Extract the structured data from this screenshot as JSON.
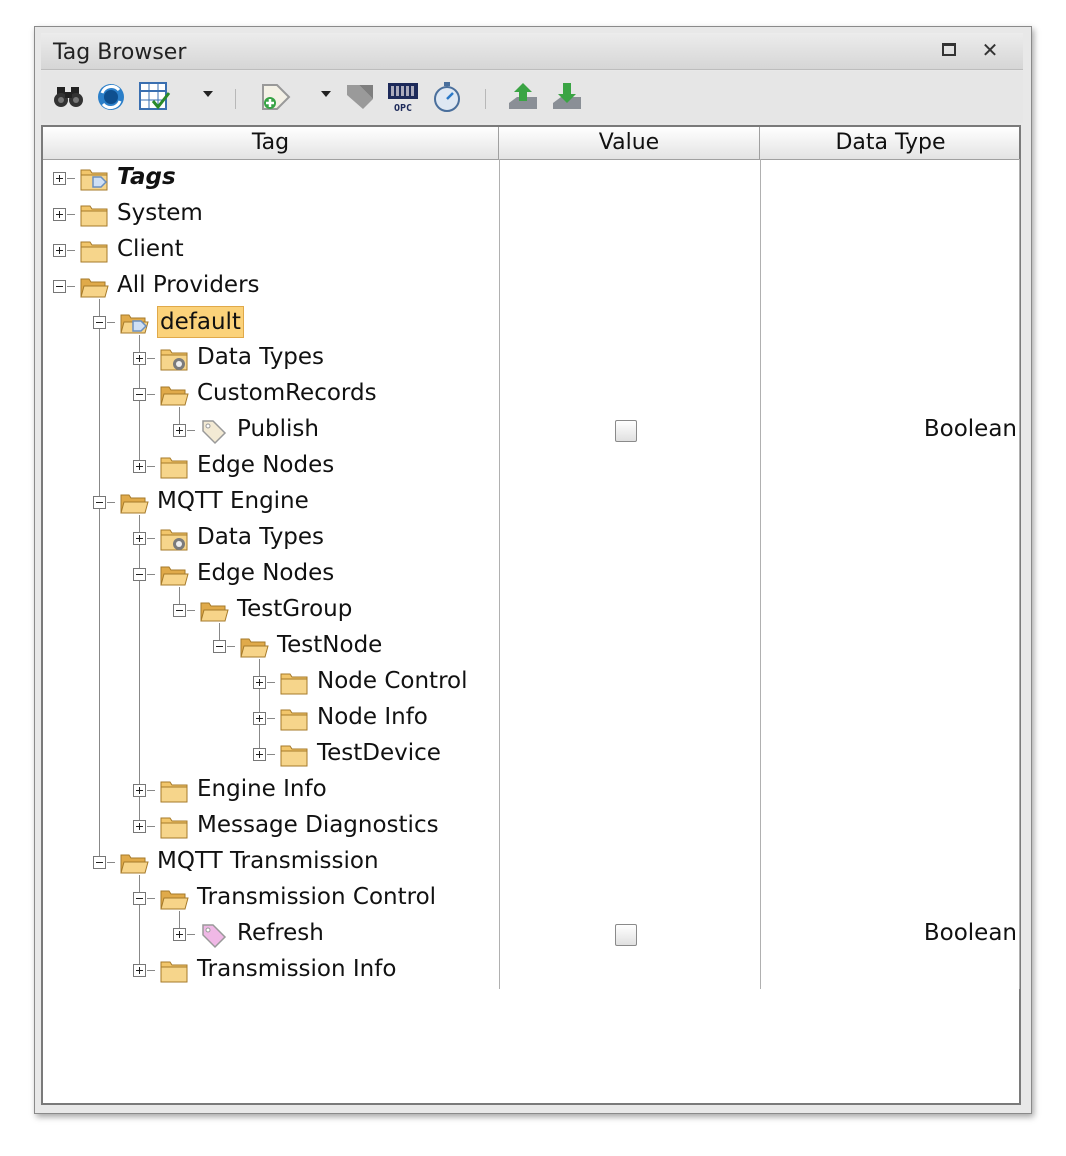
{
  "window": {
    "title": "Tag Browser"
  },
  "columns": [
    "Tag",
    "Value",
    "Data Type"
  ],
  "toolbar": {
    "icons": [
      "binoculars-icon",
      "refresh-icon",
      "table-check-icon",
      "dropdown-caret-icon",
      "add-tag-icon",
      "dropdown-caret-icon",
      "tag-disabled-icon",
      "opc-icon",
      "timer-icon",
      "export-icon",
      "import-icon"
    ]
  },
  "tree": [
    {
      "label": "Tags",
      "level": 0,
      "expanded": false,
      "icon": "tags-folder-icon",
      "style": "bold"
    },
    {
      "label": "System",
      "level": 0,
      "expanded": false,
      "icon": "folder-icon"
    },
    {
      "label": "Client",
      "level": 0,
      "expanded": false,
      "icon": "folder-icon"
    },
    {
      "label": "All Providers",
      "level": 0,
      "expanded": true,
      "icon": "folder-open-icon"
    },
    {
      "label": "default",
      "level": 1,
      "expanded": true,
      "icon": "tags-folder-open-icon",
      "selected": true
    },
    {
      "label": "Data Types",
      "level": 2,
      "expanded": false,
      "icon": "datatypes-folder-icon"
    },
    {
      "label": "CustomRecords",
      "level": 2,
      "expanded": true,
      "icon": "folder-open-icon"
    },
    {
      "label": "Publish",
      "level": 3,
      "expanded": false,
      "icon": "tag-icon",
      "value": "checkbox",
      "dtype": "Boolean"
    },
    {
      "label": "Edge Nodes",
      "level": 2,
      "expanded": false,
      "icon": "folder-icon"
    },
    {
      "label": "MQTT Engine",
      "level": 1,
      "expanded": true,
      "icon": "folder-open-icon"
    },
    {
      "label": "Data Types",
      "level": 2,
      "expanded": false,
      "icon": "datatypes-folder-icon"
    },
    {
      "label": "Edge Nodes",
      "level": 2,
      "expanded": true,
      "icon": "folder-open-icon"
    },
    {
      "label": "TestGroup",
      "level": 3,
      "expanded": true,
      "icon": "folder-open-icon"
    },
    {
      "label": "TestNode",
      "level": 4,
      "expanded": true,
      "icon": "folder-open-icon"
    },
    {
      "label": "Node Control",
      "level": 5,
      "expanded": false,
      "icon": "folder-icon"
    },
    {
      "label": "Node Info",
      "level": 5,
      "expanded": false,
      "icon": "folder-icon"
    },
    {
      "label": "TestDevice",
      "level": 5,
      "expanded": false,
      "icon": "folder-icon"
    },
    {
      "label": "Engine Info",
      "level": 2,
      "expanded": false,
      "icon": "folder-icon"
    },
    {
      "label": "Message Diagnostics",
      "level": 2,
      "expanded": false,
      "icon": "folder-icon"
    },
    {
      "label": "MQTT Transmission",
      "level": 1,
      "expanded": true,
      "icon": "folder-open-icon"
    },
    {
      "label": "Transmission Control",
      "level": 2,
      "expanded": true,
      "icon": "folder-open-icon"
    },
    {
      "label": "Refresh",
      "level": 3,
      "expanded": false,
      "icon": "tag-pink-icon",
      "value": "checkbox",
      "dtype": "Boolean"
    },
    {
      "label": "Transmission Info",
      "level": 2,
      "expanded": false,
      "icon": "folder-icon"
    }
  ],
  "colors": {
    "selection": "#fbd27a",
    "folder": "#f2c66b"
  }
}
